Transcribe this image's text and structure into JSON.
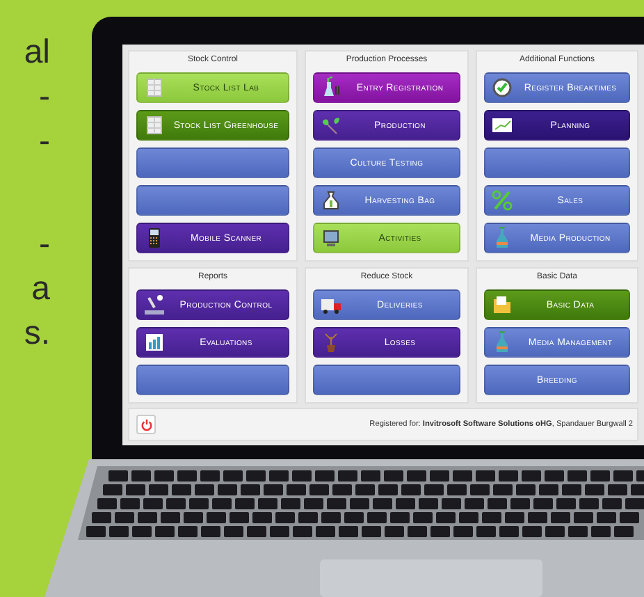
{
  "side_text": [
    [
      "al",
      "-",
      "-"
    ],
    [
      "-",
      "a",
      "s."
    ]
  ],
  "sections": [
    {
      "title": "Stock Control",
      "buttons": [
        {
          "label": "Stock List Lab",
          "kind": "light-green"
        },
        {
          "label": "Stock List Greenhouse",
          "kind": "green"
        },
        {
          "kind": "blue"
        },
        {
          "kind": "blue"
        },
        {
          "label": "Mobile Scanner",
          "kind": "purple"
        }
      ]
    },
    {
      "title": "Production Processes",
      "buttons": [
        {
          "label": "Entry Registration",
          "kind": "magenta"
        },
        {
          "label": "Production",
          "kind": "purple"
        },
        {
          "label": "Culture Testing",
          "kind": "blue"
        },
        {
          "label": "Harvesting Bag",
          "kind": "blue"
        },
        {
          "label": "Activities",
          "kind": "light-green"
        }
      ]
    },
    {
      "title": "Additional Functions",
      "buttons": [
        {
          "label": "Register Breaktimes",
          "kind": "blue"
        },
        {
          "label": "Planning",
          "kind": "indigo"
        },
        {
          "kind": "blue"
        },
        {
          "label": "Sales",
          "kind": "blue"
        },
        {
          "label": "Media Production",
          "kind": "blue"
        }
      ]
    },
    {
      "title": "Reports",
      "buttons": [
        {
          "label": "Production Control",
          "kind": "purple"
        },
        {
          "label": "Evaluations",
          "kind": "purple"
        },
        {
          "kind": "blue"
        }
      ]
    },
    {
      "title": "Reduce Stock",
      "buttons": [
        {
          "label": "Deliveries",
          "kind": "blue"
        },
        {
          "label": "Losses",
          "kind": "purple"
        },
        {
          "kind": "blue"
        }
      ]
    },
    {
      "title": "Basic Data",
      "buttons": [
        {
          "label": "Basic Data",
          "kind": "green"
        },
        {
          "label": "Media Management",
          "kind": "blue"
        },
        {
          "label": "Breeding",
          "kind": "blue"
        }
      ]
    }
  ],
  "footer": {
    "registration": "Registered for: **Invitrosoft Software Solutions oHG**, Spandauer Burgwall 2"
  }
}
